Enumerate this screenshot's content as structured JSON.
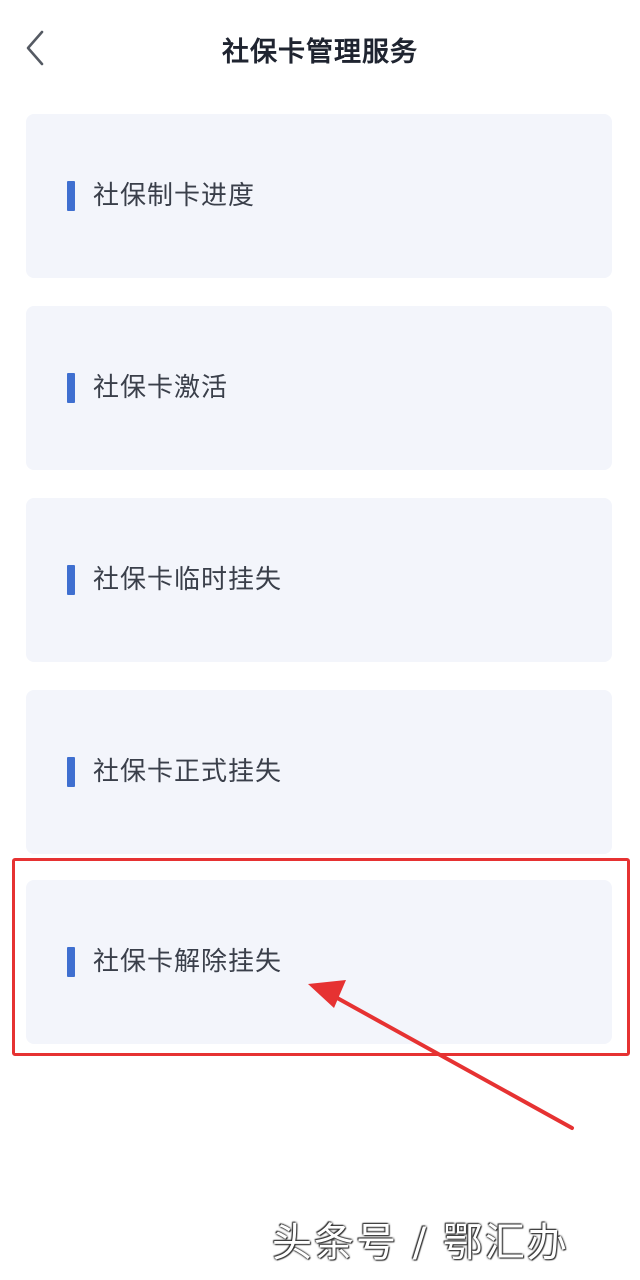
{
  "header": {
    "title": "社保卡管理服务",
    "back_icon": "chevron-left-icon"
  },
  "menu": {
    "items": [
      {
        "label": "社保制卡进度"
      },
      {
        "label": "社保卡激活"
      },
      {
        "label": "社保卡临时挂失"
      },
      {
        "label": "社保卡正式挂失"
      },
      {
        "label": "社保卡解除挂失"
      }
    ]
  },
  "annotation": {
    "highlighted_item": "社保卡解除挂失",
    "color": "#e63232"
  },
  "watermark": {
    "text": "头条号 / 鄂汇办"
  },
  "colors": {
    "accent": "#3f6fd0",
    "card_background": "#f3f5fb",
    "title_text": "#1f2430",
    "label_text": "#3a3f4a"
  }
}
